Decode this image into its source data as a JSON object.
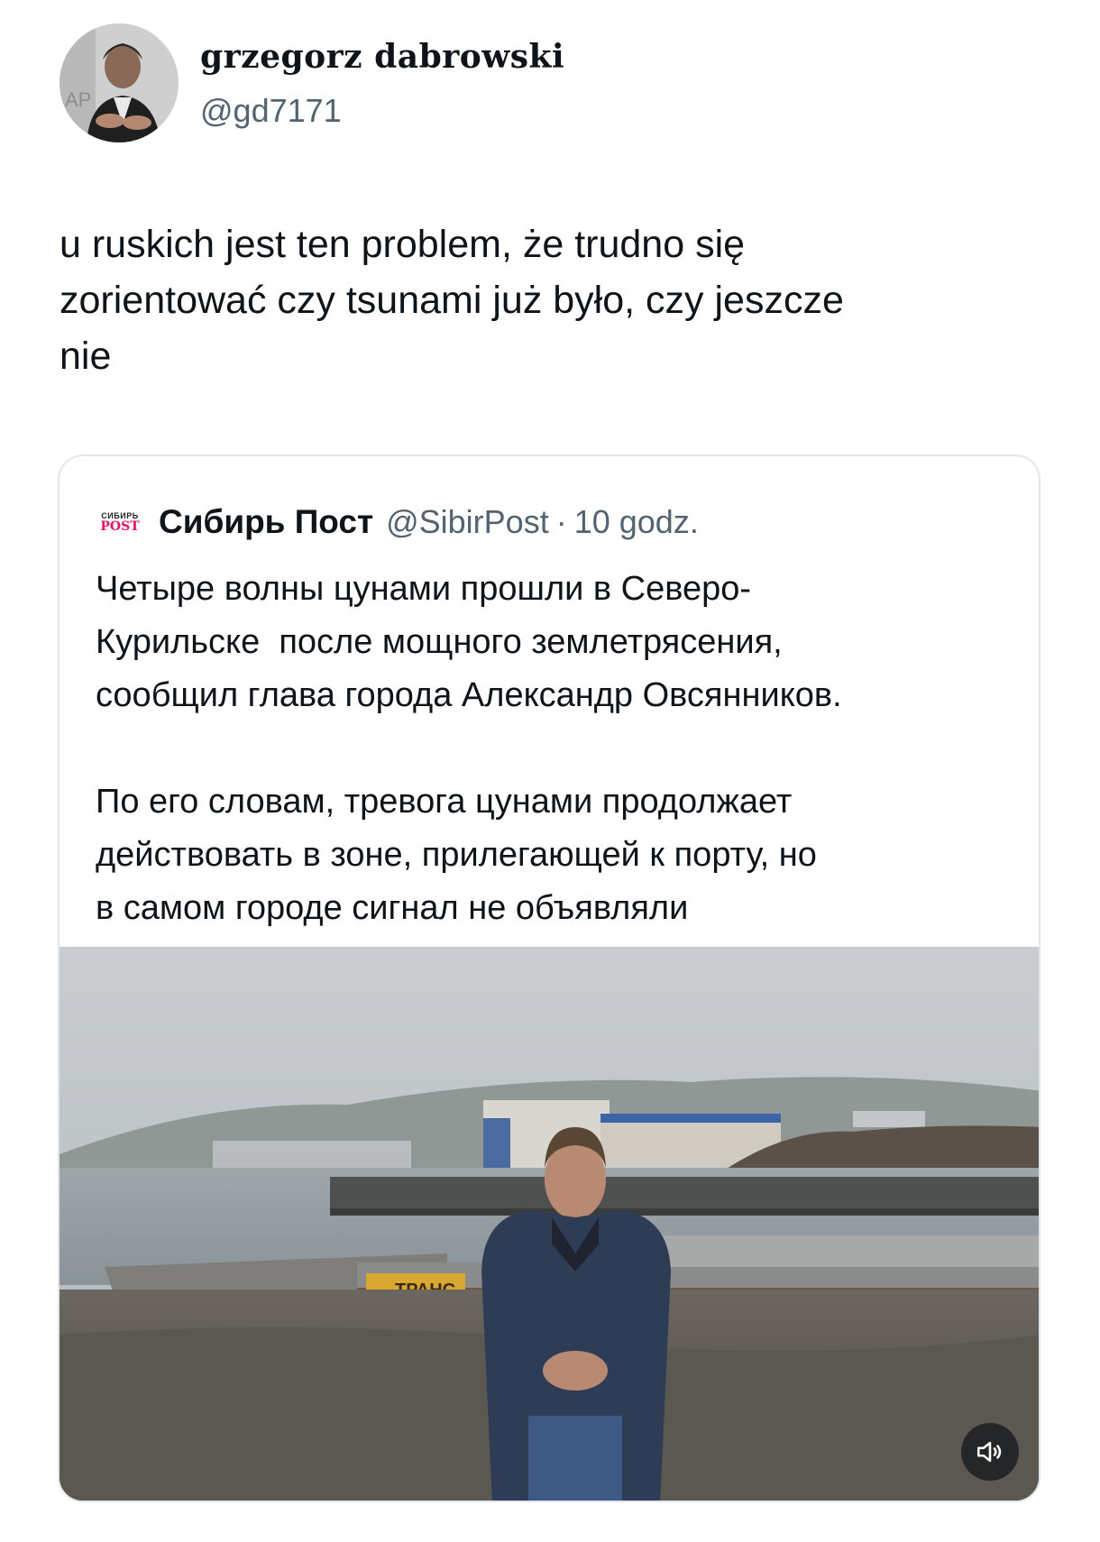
{
  "author": {
    "display_name": "grzegorz dabrowski",
    "handle": "@gd7171",
    "avatar_icon": "user-avatar-photo"
  },
  "tweet": {
    "text": "u ruskich jest ten problem, że trudno się\nzorientować czy tsunami już było, czy jeszcze\nnie"
  },
  "quote": {
    "logo_top": "СИБИРЬ",
    "logo_bottom": "POST",
    "display_name": "Сибирь Пост",
    "handle": "@SibirPost",
    "separator": "·",
    "time": "10 godz.",
    "text": "Четыре волны цунами прошли в Северо-\nКурильске  после мощного землетрясения,\nсообщил глава города Александр Овсянников.\n\nПо его словам, тревога цунами продолжает\nдействовать в зоне, прилегающей к порту, но\nв самом городе сигнал не объявляли",
    "media": {
      "sign_text": "ТРАНС",
      "sound_icon": "speaker-volume-icon"
    }
  },
  "colors": {
    "text_primary": "#0f1419",
    "text_secondary": "#536471",
    "border": "#e1e6ea",
    "logo_accent": "#e2136e"
  }
}
